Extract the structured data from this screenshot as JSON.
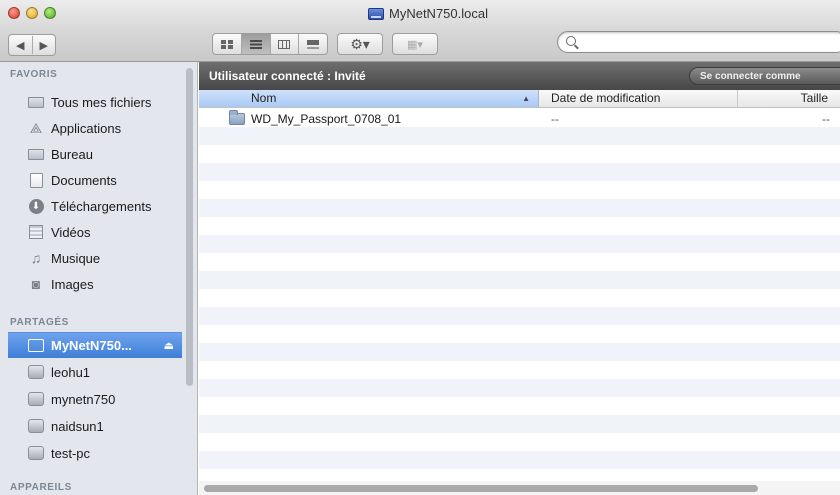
{
  "window": {
    "title": "MyNetN750.local"
  },
  "toolbar": {
    "back_glyph": "◀",
    "forward_glyph": "▶",
    "view_modes": [
      "icon-view",
      "list-view",
      "column-view",
      "coverflow-view"
    ],
    "active_view": "list-view",
    "action_glyph": "⚙▾",
    "arrange_glyph": "▦▾",
    "search": {
      "value": "",
      "placeholder": ""
    }
  },
  "sidebar": {
    "favoris_header": "FAVORIS",
    "favoris": [
      {
        "label": "Tous mes fichiers",
        "icon": "all-files-icon"
      },
      {
        "label": "Applications",
        "icon": "applications-icon"
      },
      {
        "label": "Bureau",
        "icon": "desktop-icon"
      },
      {
        "label": "Documents",
        "icon": "documents-icon"
      },
      {
        "label": "Téléchargements",
        "icon": "downloads-icon"
      },
      {
        "label": "Vidéos",
        "icon": "movies-icon"
      },
      {
        "label": "Musique",
        "icon": "music-icon"
      },
      {
        "label": "Images",
        "icon": "pictures-icon"
      }
    ],
    "partages_header": "PARTAGÉS",
    "partages": [
      {
        "label": "MyNetN750...",
        "icon": "network-screen-icon",
        "selected": true
      },
      {
        "label": "leohu1",
        "icon": "network-disk-icon"
      },
      {
        "label": "mynetn750",
        "icon": "network-disk-icon"
      },
      {
        "label": "naidsun1",
        "icon": "network-disk-icon"
      },
      {
        "label": "test-pc",
        "icon": "network-disk-icon"
      }
    ],
    "appareils_header": "APPAREILS"
  },
  "content": {
    "user_status": "Utilisateur connecté : Invité",
    "connect_button": "Se connecter comme",
    "columns": {
      "name": "Nom",
      "date": "Date de modification",
      "size": "Taille"
    },
    "files": [
      {
        "name": "WD_My_Passport_0708_01",
        "date": "--",
        "size": "--"
      }
    ]
  },
  "colors": {
    "selection": "#3e7fd6",
    "sidebar_bg": "#e3e7ed",
    "userbar": "#474747",
    "row_alt": "#f0f4fa"
  }
}
